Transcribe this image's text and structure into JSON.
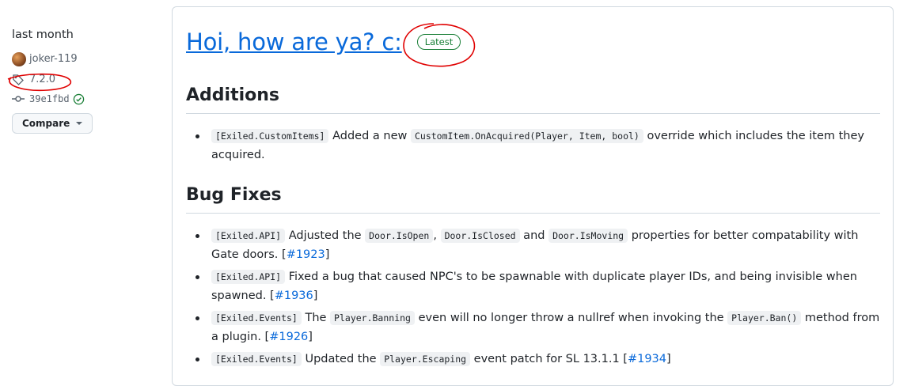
{
  "sidebar": {
    "time": "last month",
    "author": "joker-119",
    "tag": "7.2.0",
    "commit": "39e1fbd",
    "compare_label": "Compare"
  },
  "release": {
    "title": "Hoi, how are ya? c:",
    "badge": "Latest",
    "sections": [
      {
        "heading": "Additions",
        "items": [
          {
            "segments": [
              {
                "t": "code",
                "v": "[Exiled.CustomItems]"
              },
              {
                "t": "text",
                "v": " Added a new "
              },
              {
                "t": "code",
                "v": "CustomItem.OnAcquired(Player, Item, bool)"
              },
              {
                "t": "text",
                "v": " override which includes the item they acquired."
              }
            ]
          }
        ]
      },
      {
        "heading": "Bug Fixes",
        "items": [
          {
            "segments": [
              {
                "t": "code",
                "v": "[Exiled.API]"
              },
              {
                "t": "text",
                "v": " Adjusted the "
              },
              {
                "t": "code",
                "v": "Door.IsOpen"
              },
              {
                "t": "text",
                "v": ", "
              },
              {
                "t": "code",
                "v": "Door.IsClosed"
              },
              {
                "t": "text",
                "v": " and "
              },
              {
                "t": "code",
                "v": "Door.IsMoving"
              },
              {
                "t": "text",
                "v": " properties for better compatability with Gate doors. ["
              },
              {
                "t": "link",
                "v": "#1923"
              },
              {
                "t": "text",
                "v": "]"
              }
            ]
          },
          {
            "segments": [
              {
                "t": "code",
                "v": "[Exiled.API]"
              },
              {
                "t": "text",
                "v": " Fixed a bug that caused NPC's to be spawnable with duplicate player IDs, and being invisible when spawned. ["
              },
              {
                "t": "link",
                "v": "#1936"
              },
              {
                "t": "text",
                "v": "]"
              }
            ]
          },
          {
            "segments": [
              {
                "t": "code",
                "v": "[Exiled.Events]"
              },
              {
                "t": "text",
                "v": " The "
              },
              {
                "t": "code",
                "v": "Player.Banning"
              },
              {
                "t": "text",
                "v": " even will no longer throw a nullref when invoking the "
              },
              {
                "t": "code",
                "v": "Player.Ban()"
              },
              {
                "t": "text",
                "v": " method from a plugin. ["
              },
              {
                "t": "link",
                "v": "#1926"
              },
              {
                "t": "text",
                "v": "]"
              }
            ]
          },
          {
            "segments": [
              {
                "t": "code",
                "v": "[Exiled.Events]"
              },
              {
                "t": "text",
                "v": " Updated the "
              },
              {
                "t": "code",
                "v": "Player.Escaping"
              },
              {
                "t": "text",
                "v": " event patch for SL 13.1.1 ["
              },
              {
                "t": "link",
                "v": "#1934"
              },
              {
                "t": "text",
                "v": "]"
              }
            ]
          }
        ]
      }
    ]
  },
  "colors": {
    "link": "#0969da",
    "badge_green": "#1a7f37",
    "annotation_red": "#e00000"
  }
}
